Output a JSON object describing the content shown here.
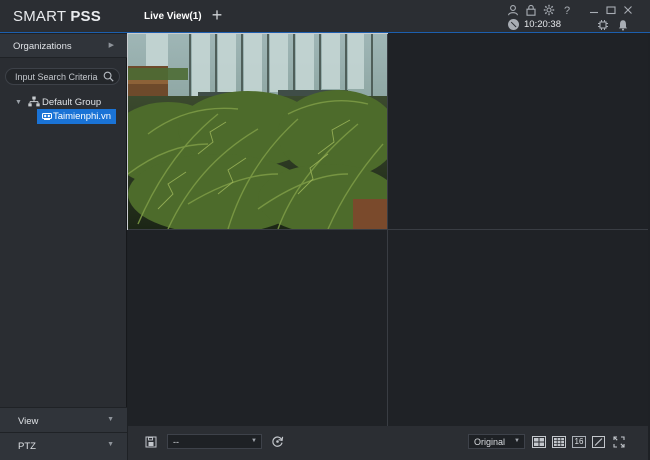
{
  "app": {
    "logo_prefix": "SMART",
    "logo_suffix": "PSS",
    "tab_label": "Live View(1)",
    "add_tab": "+",
    "time": "10:20:38"
  },
  "sidebar": {
    "organizations_label": "Organizations",
    "search_placeholder": "Input Search Criteria",
    "tree": {
      "group_label": "Default Group",
      "device_label": "Taimienphi.vn"
    },
    "view_label": "View",
    "ptz_label": "PTZ"
  },
  "toolbar": {
    "preset_value": "--",
    "stream_value": "Original",
    "layout_16_label": "16"
  },
  "colors": {
    "accent": "#1a73d6",
    "background": "#1e2125",
    "panel": "#2b2e33"
  }
}
